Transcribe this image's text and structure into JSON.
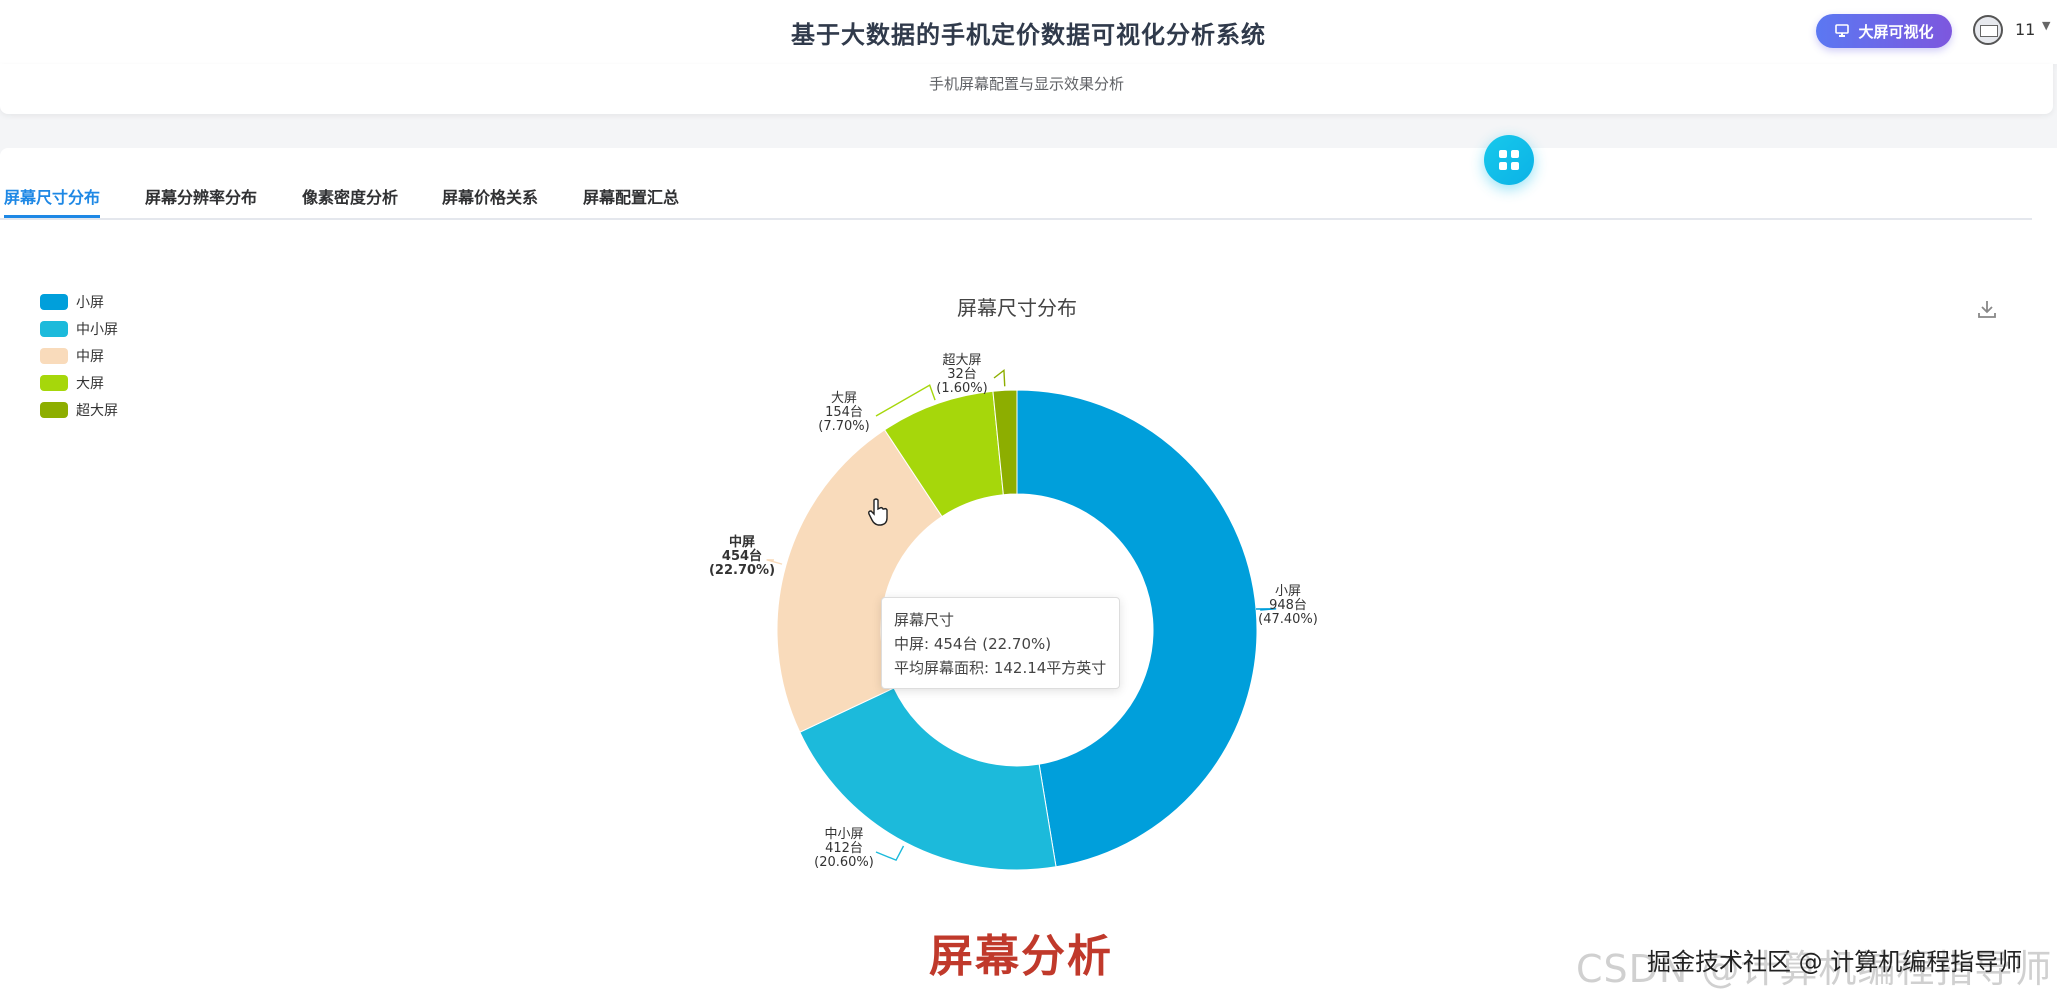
{
  "header": {
    "title": "基于大数据的手机定价数据可视化分析系统",
    "big_screen_label": "大屏可视化",
    "user_name": "11"
  },
  "page": {
    "subtitle": "手机屏幕配置与显示效果分析"
  },
  "tabs": [
    {
      "label": "屏幕尺寸分布",
      "active": true
    },
    {
      "label": "屏幕分辨率分布",
      "active": false
    },
    {
      "label": "像素密度分析",
      "active": false
    },
    {
      "label": "屏幕价格关系",
      "active": false
    },
    {
      "label": "屏幕配置汇总",
      "active": false
    }
  ],
  "chart_data": {
    "type": "pie",
    "title": "屏幕尺寸分布",
    "donut": true,
    "legend": {
      "placement": "top-left"
    },
    "series": [
      {
        "name": "小屏",
        "value": 948,
        "value_label": "948台",
        "percent_label": "(47.40%)",
        "color": "#009fdb"
      },
      {
        "name": "中小屏",
        "value": 412,
        "value_label": "412台",
        "percent_label": "(20.60%)",
        "color": "#1cbadb"
      },
      {
        "name": "中屏",
        "value": 454,
        "value_label": "454台",
        "percent_label": "(22.70%)",
        "color": "#f9dbbb"
      },
      {
        "name": "大屏",
        "value": 154,
        "value_label": "154台",
        "percent_label": "(7.70%)",
        "color": "#a6d70b"
      },
      {
        "name": "超大屏",
        "value": 32,
        "value_label": "32台",
        "percent_label": "(1.60%)",
        "color": "#8dae00"
      }
    ],
    "tooltip": {
      "title": "屏幕尺寸",
      "line1": "中屏: 454台 (22.70%)",
      "line2": "平均屏幕面积: 142.14平方英寸"
    }
  },
  "caption": "屏幕分析",
  "watermark": {
    "csdn": "CSDN @计算机编程指导师",
    "juejin": "掘金技术社区 @ 计算机编程指导师"
  }
}
